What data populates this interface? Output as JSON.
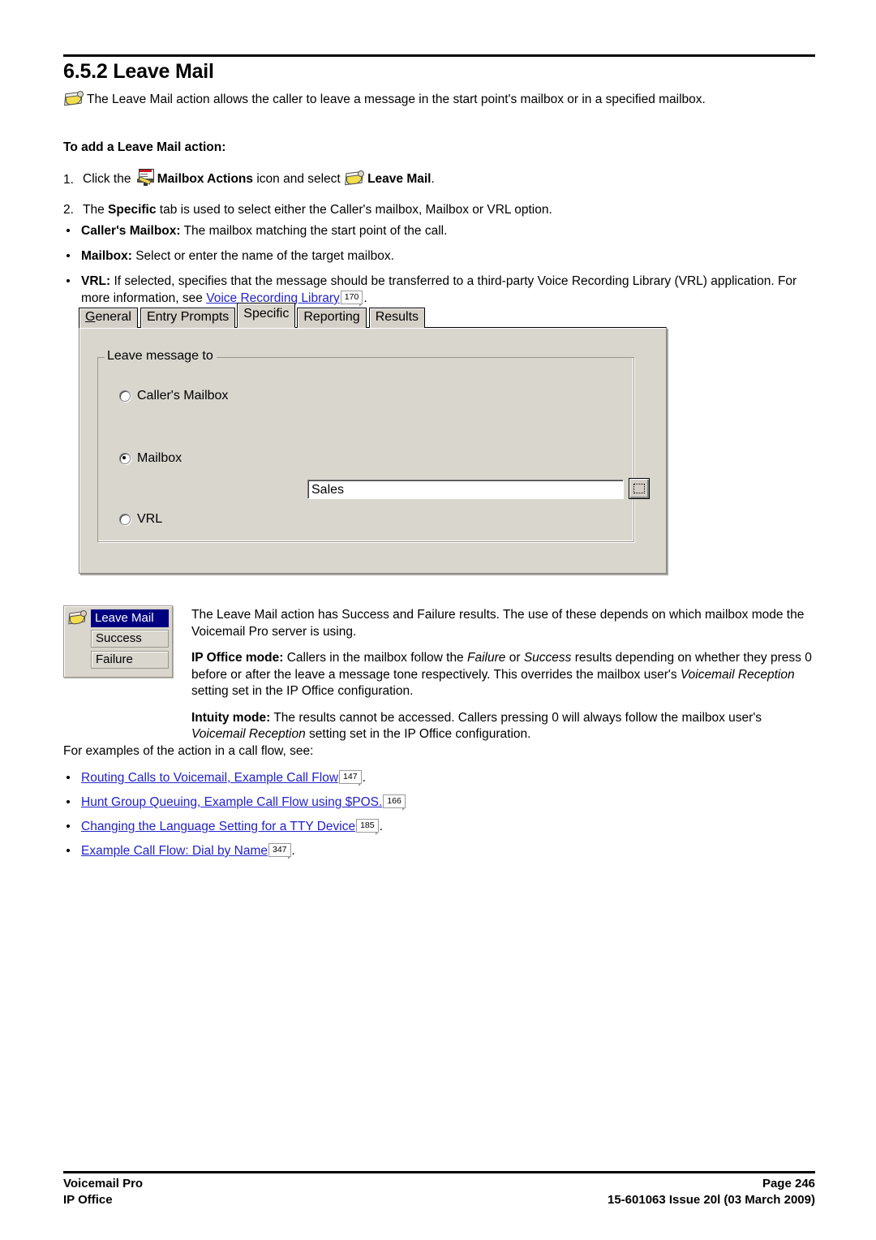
{
  "document": {
    "section_number": "6.5.2",
    "title": "6.5.2 Leave Mail",
    "intro": "The Leave Mail action allows the caller to leave a message in the start point's mailbox or in a specified mailbox.",
    "subhead": "To add a Leave Mail action:"
  },
  "icons": {
    "leave_mail": "leave-mail-icon",
    "mailbox_actions": "mailbox-actions-icon"
  },
  "steps": [
    {
      "number": "1.",
      "pre": "Click the",
      "bold1": "Mailbox Actions",
      "mid": "icon and select",
      "bold2": "Leave Mail",
      "post": "."
    },
    {
      "number": "2.",
      "pre": "The",
      "bold1": "Specific",
      "post": "tab is used to select either the Caller's mailbox, Mailbox or VRL option."
    }
  ],
  "option_bullets": [
    {
      "label": "Caller's Mailbox:",
      "text": "The mailbox matching the start point of the call."
    },
    {
      "label": "Mailbox:",
      "text": "Select or enter the name of the target mailbox."
    },
    {
      "label": "VRL:",
      "text": "If selected, specifies that the message should be transferred to a third-party Voice Recording Library (VRL) application. For more information, see",
      "link": "Voice Recording Library",
      "pageref": "170",
      "tail": "."
    }
  ],
  "dialog": {
    "tabs": [
      {
        "label": "General",
        "accel": "G",
        "rest": "eneral",
        "active": false
      },
      {
        "label": "Entry Prompts",
        "active": false
      },
      {
        "label": "Specific",
        "active": true
      },
      {
        "label": "Reporting",
        "active": false
      },
      {
        "label": "Results",
        "active": false
      }
    ],
    "groupbox_title": "Leave message to",
    "radios": [
      {
        "label": "Caller's Mailbox",
        "checked": false
      },
      {
        "label": "Mailbox",
        "checked": true
      },
      {
        "label": "VRL",
        "checked": false
      }
    ],
    "mailbox_value": "Sales",
    "browse_label": "...",
    "colors": {
      "face": "#d9d6ce",
      "tab_face": "#d4d0c8",
      "selection": "#000080",
      "field": "#ffffff"
    }
  },
  "results_box": {
    "items": [
      {
        "label": "Leave Mail",
        "selected": true
      },
      {
        "label": "Success",
        "selected": false
      },
      {
        "label": "Failure",
        "selected": false
      }
    ]
  },
  "results_text": {
    "p1": "The Leave Mail action has Success and Failure results. The use of these depends on which mailbox mode the Voicemail Pro server is using.",
    "p2_label": "IP Office mode:",
    "p2_a": "Callers in the mailbox follow the",
    "p2_i1": "Failure",
    "p2_b": "or",
    "p2_i2": "Success",
    "p2_c": "results depending on whether they press 0 before or after the leave a message tone respectively. This overrides the mailbox user's",
    "p2_i3": "Voicemail Reception",
    "p2_d": "setting set in the IP Office configuration.",
    "p3_label": "Intuity mode:",
    "p3_a": "The results cannot be accessed. Callers pressing 0 will always follow the mailbox user's",
    "p3_i1": "Voicemail Reception",
    "p3_b": "setting set in the IP Office configuration."
  },
  "examples": {
    "intro": "For examples of the action in a call flow, see:",
    "items": [
      {
        "link": "Routing Calls to Voicemail, Example Call Flow",
        "pageref": "147",
        "tail": "."
      },
      {
        "link": "Hunt Group Queuing, Example Call Flow using $POS.",
        "pageref": "166",
        "tail": ""
      },
      {
        "link": "Changing the Language Setting for a TTY Device",
        "pageref": "185",
        "tail": "."
      },
      {
        "link": "Example Call Flow: Dial by Name",
        "pageref": "347",
        "tail": "."
      }
    ]
  },
  "footer": {
    "left_line1": "Voicemail Pro",
    "left_line2": "IP Office",
    "right_line1": "Page 246",
    "right_line2": "15-601063 Issue 20l (03 March 2009)"
  }
}
